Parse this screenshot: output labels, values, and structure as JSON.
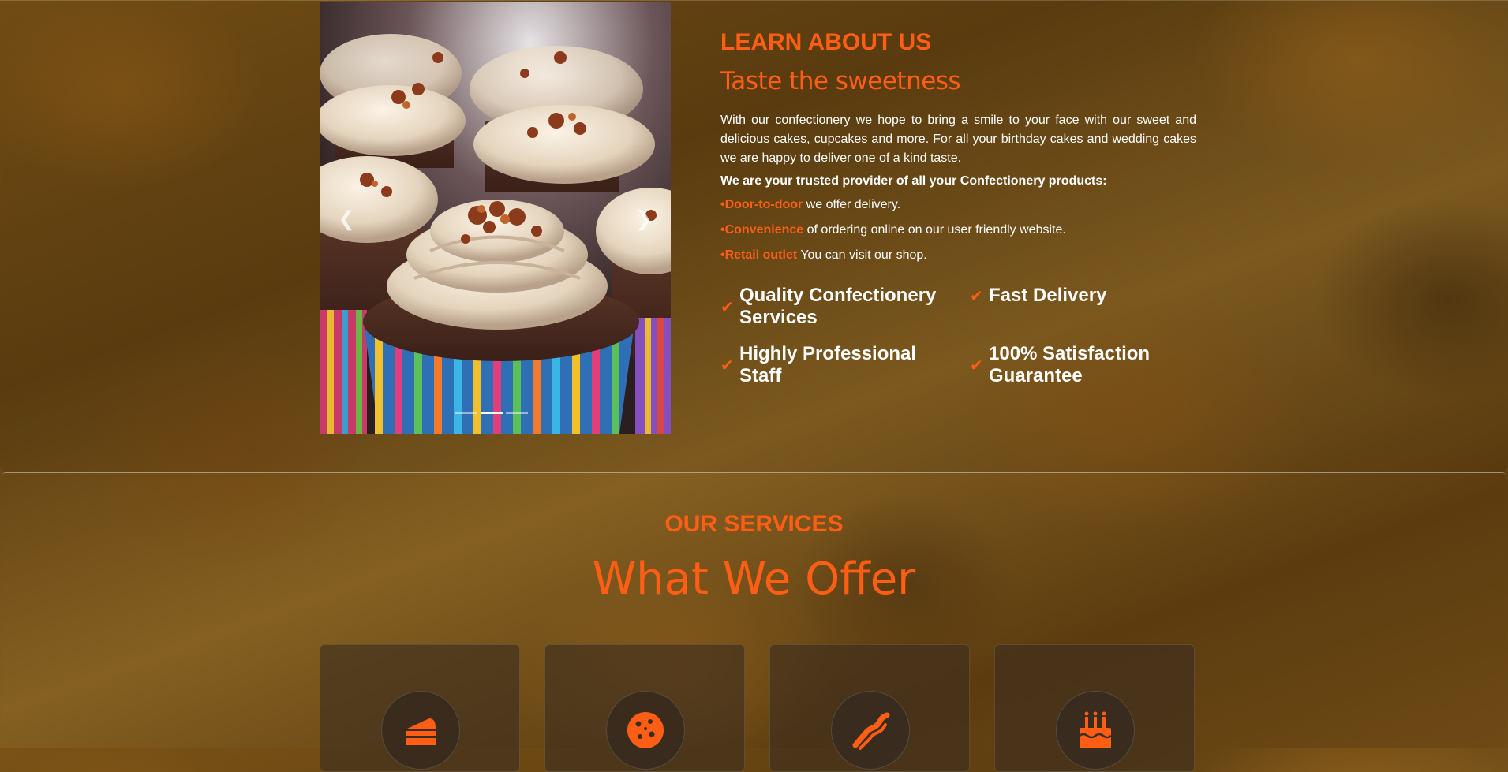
{
  "colors": {
    "accent": "#ff5e14",
    "text": "#ffffff"
  },
  "about": {
    "eyebrow": "LEARN ABOUT US",
    "title": "Taste the sweetness",
    "text": "With our confectionery we hope to bring a smile to your face with our sweet and delicious cakes, cupcakes and more. For all your birthday cakes and wedding cakes we are happy to deliver one of a kind taste.",
    "trusted": "We are your trusted provider of all your Confectionery products:",
    "points": [
      {
        "highlight": "•Door-to-door",
        "rest": " we offer delivery."
      },
      {
        "highlight": "•Convenience",
        "rest": " of ordering online on our user friendly website."
      },
      {
        "highlight": "•Retail outlet",
        "rest": " You can visit our shop."
      }
    ],
    "features": [
      "Quality Confectionery Services",
      "Fast Delivery",
      "Highly Professional Staff",
      "100% Satisfaction Guarantee"
    ]
  },
  "carousel": {
    "prev_icon": "chevron-left-icon",
    "next_icon": "chevron-right-icon",
    "slide_count": 3,
    "active_slide": 2
  },
  "services": {
    "eyebrow": "OUR SERVICES",
    "title": "What We Offer",
    "icons": [
      "cake-slice-icon",
      "cookie-icon",
      "bacon-icon",
      "birthday-cake-icon"
    ]
  }
}
